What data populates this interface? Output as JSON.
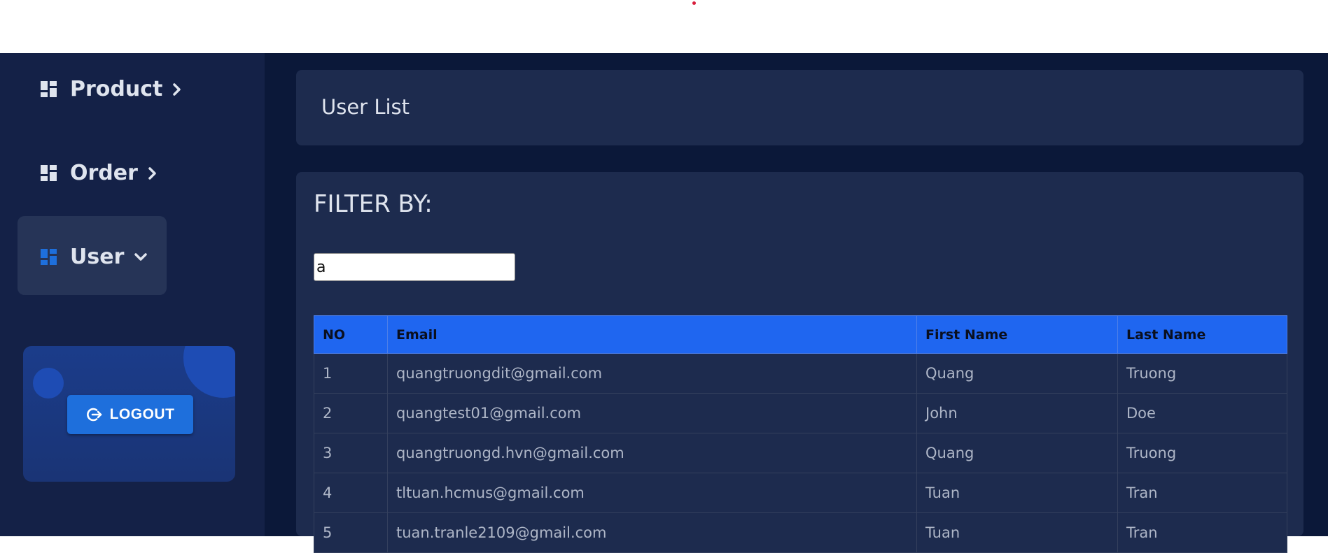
{
  "sidebar": {
    "items": [
      {
        "label": "Product",
        "icon": "dashboard-icon",
        "chevron": "chevron-right-icon",
        "active": false
      },
      {
        "label": "Order",
        "icon": "dashboard-icon",
        "chevron": "chevron-right-icon",
        "active": false
      },
      {
        "label": "User",
        "icon": "dashboard-icon",
        "chevron": "chevron-down-icon",
        "active": true
      }
    ],
    "logout_label": "LOGOUT",
    "logout_icon": "logout-icon"
  },
  "header": {
    "title": "User List"
  },
  "filter": {
    "title": "FILTER BY:",
    "input_value": "a"
  },
  "table": {
    "columns": [
      "NO",
      "Email",
      "First Name",
      "Last Name"
    ],
    "rows": [
      [
        "1",
        "quangtruongdit@gmail.com",
        "Quang",
        "Truong"
      ],
      [
        "2",
        "quangtest01@gmail.com",
        "John",
        "Doe"
      ],
      [
        "3",
        "quangtruongd.hvn@gmail.com",
        "Quang",
        "Truong"
      ],
      [
        "4",
        "tltuan.hcmus@gmail.com",
        "Tuan",
        "Tran"
      ],
      [
        "5",
        "tuan.tranle2109@gmail.com",
        "Tuan",
        "Tran"
      ]
    ]
  },
  "colors": {
    "sidebar_bg": "#142147",
    "main_bg": "#0b1839",
    "card_bg": "#1d2b4e",
    "accent": "#1f66f0",
    "active_icon": "#1e6fdc"
  }
}
